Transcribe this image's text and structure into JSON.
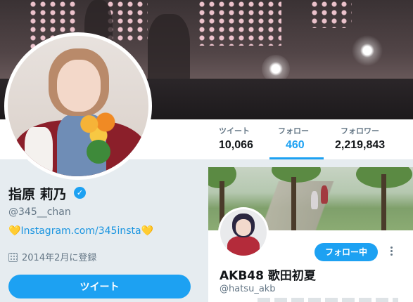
{
  "stats": [
    {
      "label": "ツイート",
      "value": "10,066"
    },
    {
      "label": "フォロー",
      "value": "460"
    },
    {
      "label": "フォロワー",
      "value": "2,219,843"
    }
  ],
  "profile": {
    "name": "指原 莉乃",
    "handle": "@345__chan",
    "bio_prefix": "💛",
    "bio_link": "Instagram.com/345insta",
    "bio_suffix": "💛",
    "joined": "2014年2月に登録",
    "tweet_button": "ツイート",
    "verified_mark": "✓"
  },
  "card": {
    "name": "AKB48 歌田初夏",
    "handle": "@hatsu_akb",
    "follow_button": "フォロー中"
  },
  "colors": {
    "accent": "#1da1f2",
    "link": "#1b95e0",
    "heart": "#f5c431"
  }
}
